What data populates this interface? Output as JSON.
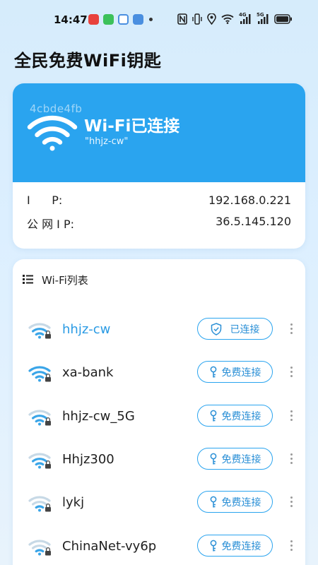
{
  "status_bar": {
    "time": "14:47",
    "left_icons": [
      "huawei-app-icon",
      "message-app-icon",
      "card-app-icon",
      "folder-app-icon",
      "more-dot-icon"
    ],
    "right_icons": [
      "nfc-icon",
      "vibrate-icon",
      "location-icon",
      "wifi-icon",
      "signal-4g-icon",
      "signal-5g-icon",
      "battery-icon"
    ],
    "net_4g": "4G",
    "net_5g": "5G"
  },
  "app": {
    "title": "全民免费WiFi钥匙"
  },
  "connection": {
    "bg_id": "4cbde4fb",
    "status": "Wi-Fi已连接",
    "ssid": "\"hhjz-cw\"",
    "ip_label": "I      P:",
    "ip_value": "192.168.0.221",
    "public_ip_label": "公 网 I P:",
    "public_ip_value": "36.5.145.120"
  },
  "wifi_list": {
    "title": "Wi-Fi列表",
    "items": [
      {
        "name": "hhjz-cw",
        "action": "已连接",
        "connected": true,
        "strength": 0.66,
        "action_icon": "shield-check-icon"
      },
      {
        "name": "xa-bank",
        "action": "免费连接",
        "connected": false,
        "strength": 1.0,
        "action_icon": "key-icon"
      },
      {
        "name": "hhjz-cw_5G",
        "action": "免费连接",
        "connected": false,
        "strength": 0.66,
        "action_icon": "key-icon"
      },
      {
        "name": "Hhjz300",
        "action": "免费连接",
        "connected": false,
        "strength": 0.66,
        "action_icon": "key-icon"
      },
      {
        "name": "lykj",
        "action": "免费连接",
        "connected": false,
        "strength": 0.33,
        "action_icon": "key-icon"
      },
      {
        "name": "ChinaNet-vy6p",
        "action": "免费连接",
        "connected": false,
        "strength": 0.33,
        "action_icon": "key-icon"
      }
    ]
  },
  "colors": {
    "accent": "#2aa4ef",
    "accent_text": "#2a8fd6",
    "connected_text": "#2a9be4",
    "wifi_on": "#3aa5e8",
    "wifi_off": "#c7d9e6"
  }
}
